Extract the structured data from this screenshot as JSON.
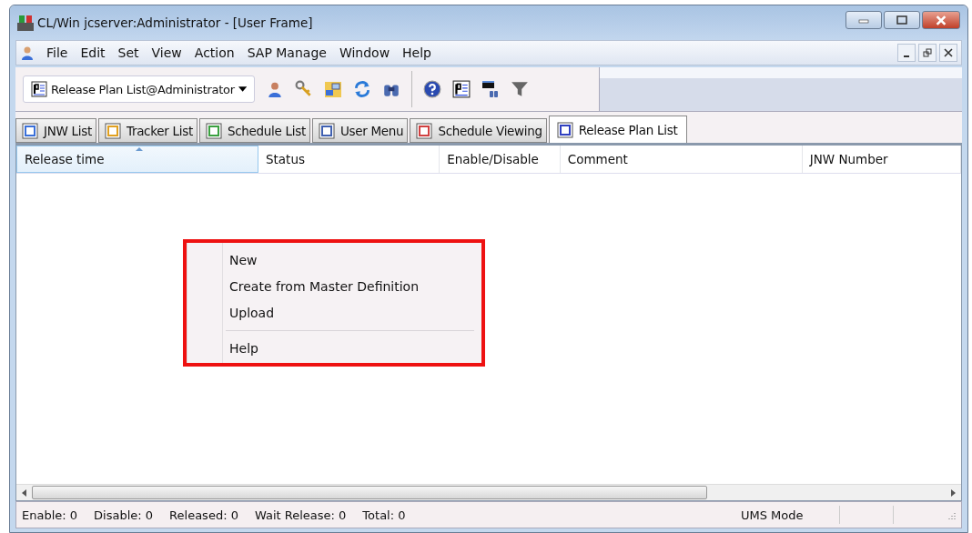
{
  "window": {
    "title": "CL/Win jcserver:Administrator - [User Frame]"
  },
  "menu_bar": [
    "File",
    "Edit",
    "Set",
    "View",
    "Action",
    "SAP Manage",
    "Window",
    "Help"
  ],
  "toolbar": {
    "view_selector": "Release Plan List@Administrator"
  },
  "tabs": [
    {
      "label": "JNW List",
      "selected": false
    },
    {
      "label": "Tracker List",
      "selected": false
    },
    {
      "label": "Schedule List",
      "selected": false
    },
    {
      "label": "User Menu",
      "selected": false
    },
    {
      "label": "Schedule Viewing",
      "selected": false
    },
    {
      "label": "Release Plan List",
      "selected": true
    }
  ],
  "table": {
    "columns": [
      {
        "label": "Release time",
        "sorted": true
      },
      {
        "label": "Status",
        "sorted": false
      },
      {
        "label": "Enable/Disable",
        "sorted": false
      },
      {
        "label": "Comment",
        "sorted": false
      },
      {
        "label": "JNW Number",
        "sorted": false
      }
    ]
  },
  "context_menu": {
    "items": [
      {
        "kind": "item",
        "label": "New"
      },
      {
        "kind": "item",
        "label": "Create from Master Definition"
      },
      {
        "kind": "item",
        "label": "Upload"
      },
      {
        "kind": "separator"
      },
      {
        "kind": "item",
        "label": "Help"
      }
    ]
  },
  "status_bar": {
    "counts": [
      "Enable: 0",
      "Disable: 0",
      "Released: 0",
      "Wait Release: 0",
      "Total: 0"
    ],
    "mode": "UMS Mode"
  }
}
